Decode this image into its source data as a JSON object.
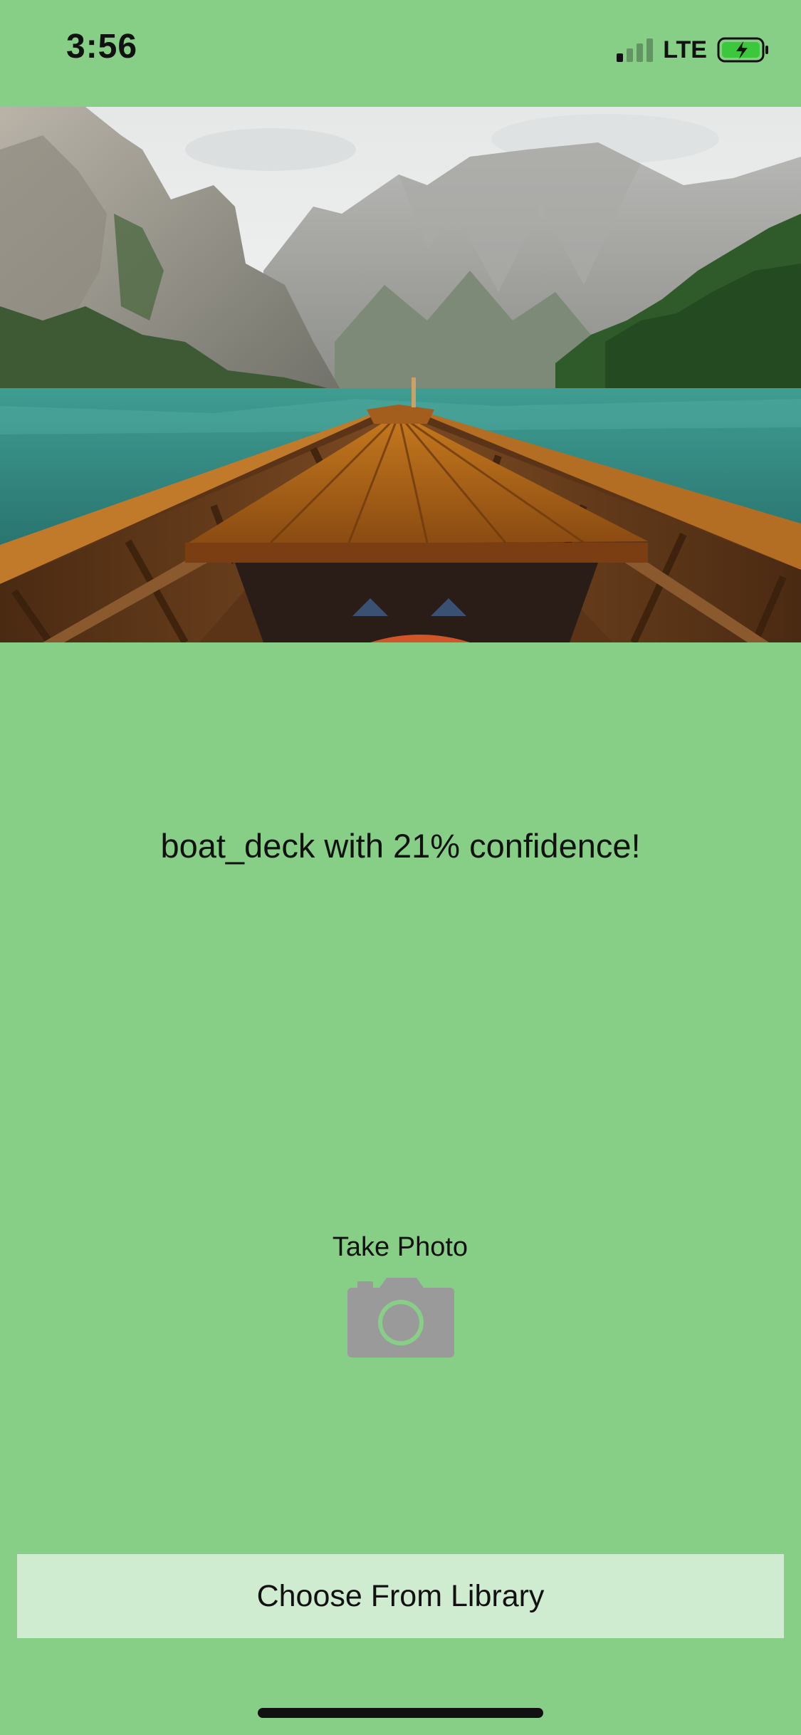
{
  "status_bar": {
    "time": "3:56",
    "network": "LTE",
    "signal_bars_filled": 1,
    "signal_bars_total": 4,
    "battery_charging": true,
    "battery_color": "#3cc83c"
  },
  "photo": {
    "subject": "boat bow on mountain lake"
  },
  "result": {
    "text": "boat_deck with 21% confidence!"
  },
  "take_photo": {
    "label": "Take Photo",
    "icon": "camera-icon"
  },
  "library": {
    "label": "Choose From Library"
  },
  "colors": {
    "background": "#87cf87",
    "button_background": "#d0ecd0",
    "icon_gray": "#9a9a9a"
  }
}
